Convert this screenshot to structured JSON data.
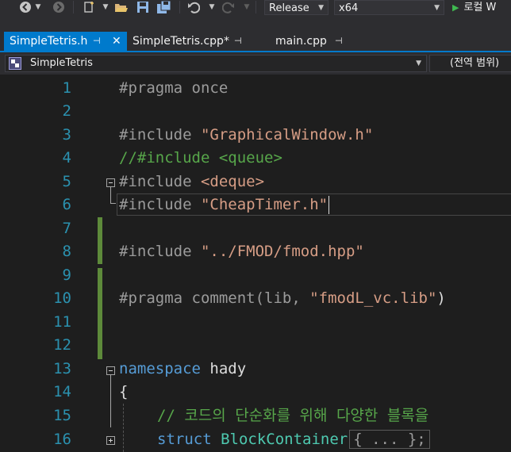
{
  "toolbar": {
    "configuration": "Release",
    "platform": "x64",
    "run_label": "로컬 W",
    "icons": [
      "back-icon",
      "forward-icon",
      "new-project-icon",
      "open-file-icon",
      "save-icon",
      "save-all-icon",
      "undo-icon",
      "redo-icon",
      "play-icon"
    ]
  },
  "tabs": [
    {
      "label": "SimpleTetris.h",
      "active": true
    },
    {
      "label": "SimpleTetris.cpp*",
      "active": false
    },
    {
      "label": "main.cpp",
      "active": false
    }
  ],
  "navbar": {
    "scope": "SimpleTetris",
    "member": "(전역 범위)"
  },
  "editor": {
    "line_numbers": [
      "1",
      "2",
      "3",
      "4",
      "5",
      "6",
      "7",
      "8",
      "9",
      "10",
      "11",
      "12",
      "13",
      "14",
      "15",
      "16"
    ],
    "lines": {
      "l1_pragma": "#pragma once",
      "l3_include": "#include ",
      "l3_file": "\"GraphicalWindow.h\"",
      "l4_comment": "//#include <queue>",
      "l5_include": "#include ",
      "l5_file": "<deque>",
      "l6_include": "#include ",
      "l6_file": "\"CheapTimer.h\"",
      "l8_include": "#include ",
      "l8_file": "\"../FMOD/fmod.hpp\"",
      "l10_pragma": "#pragma ",
      "l10_comment_kw": "comment",
      "l10_open": "(lib, ",
      "l10_file": "\"fmodL_vc.lib\"",
      "l10_close": ")",
      "l13_namespace": "namespace",
      "l13_name": " hady",
      "l14_brace": "{",
      "l15_comment": "// 코드의 단순화를 위해 다양한 블록을",
      "l16_struct": "struct",
      "l16_name": " BlockContainer",
      "l16_collapsed": "{ ... };"
    }
  },
  "colors": {
    "accent": "#007acc",
    "keyword": "#569cd6",
    "string": "#d69d85",
    "comment": "#57a64a",
    "line_number": "#2b91af",
    "change_marker": "#5d8a3a"
  }
}
